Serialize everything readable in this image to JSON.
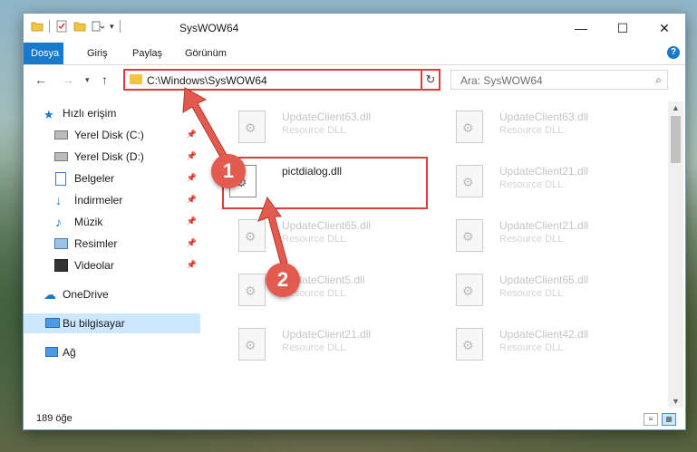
{
  "window": {
    "title": "SysWOW64",
    "controls": {
      "minimize": "—",
      "maximize": "☐",
      "close": "✕"
    }
  },
  "ribbon": {
    "tabs": [
      {
        "label": "Dosya",
        "active": true
      },
      {
        "label": "Giriş"
      },
      {
        "label": "Paylaş"
      },
      {
        "label": "Görünüm"
      }
    ],
    "help": "?"
  },
  "nav": {
    "address": "C:\\Windows\\SysWOW64",
    "search_placeholder": "Ara: SysWOW64"
  },
  "sidebar": {
    "items": [
      {
        "label": "Hızlı erişim",
        "icon": "star-icon"
      },
      {
        "label": "Yerel Disk (C:)",
        "icon": "drive-icon",
        "pinned": true
      },
      {
        "label": "Yerel Disk (D:)",
        "icon": "drive-icon",
        "pinned": true
      },
      {
        "label": "Belgeler",
        "icon": "documents-icon",
        "pinned": true
      },
      {
        "label": "İndirmeler",
        "icon": "download-icon",
        "pinned": true
      },
      {
        "label": "Müzik",
        "icon": "music-icon",
        "pinned": true
      },
      {
        "label": "Resimler",
        "icon": "pictures-icon",
        "pinned": true
      },
      {
        "label": "Videolar",
        "icon": "video-icon",
        "pinned": true
      },
      {
        "label": "OneDrive",
        "icon": "cloud-icon"
      },
      {
        "label": "Bu bilgisayar",
        "icon": "computer-icon",
        "selected": true
      },
      {
        "label": "Ağ",
        "icon": "network-icon"
      }
    ]
  },
  "files": [
    {
      "name": "UpdateClient63.dll",
      "type": "Resource DLL"
    },
    {
      "name": "UpdateClient63.dll",
      "type": "Resource DLL"
    },
    {
      "name": "pictdialog.dll",
      "type": "",
      "highlighted": true
    },
    {
      "name": "UpdateClient21.dll",
      "type": "Resource DLL"
    },
    {
      "name": "UpdateClient65.dll",
      "type": "Resource DLL"
    },
    {
      "name": "UpdateClient21.dll",
      "type": "Resource DLL"
    },
    {
      "name": "UpdateClient5.dll",
      "type": "Resource DLL"
    },
    {
      "name": "UpdateClient65.dll",
      "type": "Resource DLL"
    },
    {
      "name": "UpdateClient21.dll",
      "type": "Resource DLL"
    },
    {
      "name": "UpdateClient42.dll",
      "type": "Resource DLL"
    }
  ],
  "status": {
    "count": "189 öğe"
  },
  "callouts": [
    "1",
    "2"
  ],
  "colors": {
    "accent": "#1979ca",
    "highlight": "#e03a3a",
    "callout": "#e35a4f"
  }
}
